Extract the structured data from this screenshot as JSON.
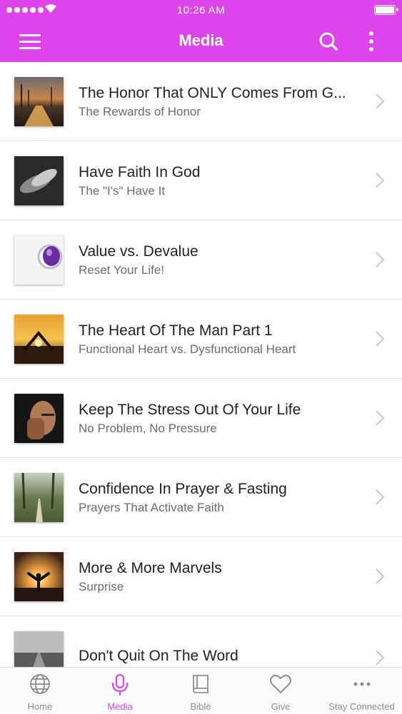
{
  "status_bar": {
    "time": "10:26 AM"
  },
  "header": {
    "title": "Media"
  },
  "icons": {
    "menu": "hamburger-icon",
    "search": "search-icon",
    "more": "more-vertical-icon"
  },
  "media_items": [
    {
      "title": "The Honor That ONLY Comes From G...",
      "subtitle": "The Rewards of Honor"
    },
    {
      "title": "Have Faith In God",
      "subtitle": "The \"I's\" Have It"
    },
    {
      "title": "Value vs. Devalue",
      "subtitle": "Reset Your Life!"
    },
    {
      "title": "The Heart Of The Man Part 1",
      "subtitle": "Functional Heart vs. Dysfunctional Heart"
    },
    {
      "title": "Keep The Stress Out Of Your Life",
      "subtitle": "No Problem, No Pressure"
    },
    {
      "title": "Confidence In Prayer & Fasting",
      "subtitle": "Prayers That Activate Faith"
    },
    {
      "title": "More & More Marvels",
      "subtitle": "Surprise"
    },
    {
      "title": "Don't Quit On The Word",
      "subtitle": ""
    }
  ],
  "tab_bar": {
    "tabs": [
      {
        "label": "Home",
        "icon": "globe-icon"
      },
      {
        "label": "Media",
        "icon": "microphone-icon",
        "active": true
      },
      {
        "label": "Bible",
        "icon": "book-icon"
      },
      {
        "label": "Give",
        "icon": "heart-icon"
      },
      {
        "label": "Stay Connected",
        "icon": "more-horizontal-icon"
      }
    ]
  },
  "colors": {
    "accent": "#dd44ec",
    "inactive": "#8e8e8e"
  }
}
